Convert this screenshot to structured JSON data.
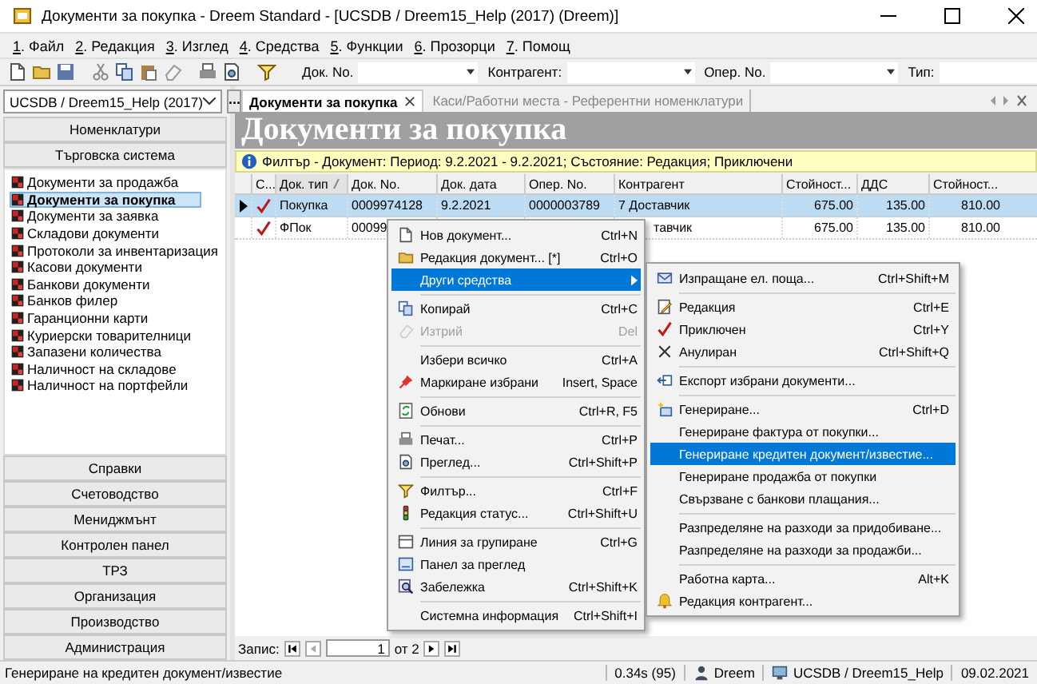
{
  "window": {
    "title": "Документи за покупка - Dreem Standard - [UCSDB / Dreem15_Help (2017) (Dreem)]"
  },
  "menu": [
    "1. Файл",
    "2. Редакция",
    "3. Изглед",
    "4. Средства",
    "5. Функции",
    "6. Прозорци",
    "7. Помощ"
  ],
  "toolbar": {
    "filters": [
      "Док. No.",
      "Контрагент:",
      "Опер. No.",
      "Тип:"
    ]
  },
  "sidebar": {
    "database": "UCSDB / Dreem15_Help (2017)",
    "more_button": "...",
    "sections_top": [
      "Номенклатури",
      "Търговска система"
    ],
    "items": [
      {
        "label": "Документи за продажба",
        "selected": false
      },
      {
        "label": "Документи за покупка",
        "selected": true
      },
      {
        "label": "Документи за заявка",
        "selected": false
      },
      {
        "label": "Складови документи",
        "selected": false
      },
      {
        "label": "Протоколи за инвентаризация",
        "selected": false
      },
      {
        "label": "Касови документи",
        "selected": false
      },
      {
        "label": "Банкови документи",
        "selected": false
      },
      {
        "label": "Банков филер",
        "selected": false
      },
      {
        "label": "Гаранционни карти",
        "selected": false
      },
      {
        "label": "Куриерски товарителници",
        "selected": false
      },
      {
        "label": "Запазени количества",
        "selected": false
      },
      {
        "label": "Наличност на складове",
        "selected": false
      },
      {
        "label": "Наличност на портфейли",
        "selected": false
      }
    ],
    "sections_bottom": [
      "Справки",
      "Счетоводство",
      "Мениджмънт",
      "Контролен панел",
      "ТРЗ",
      "Организация",
      "Производство",
      "Администрация"
    ]
  },
  "tabs": [
    {
      "label": "Документи за покупка",
      "selected": true,
      "closable": true
    },
    {
      "label": "Каси/Работни места - Референтни номенклатури",
      "selected": false,
      "closable": false
    }
  ],
  "page_title": "Документи за покупка",
  "filter_bar": "Филтър - Документ: Период: 9.2.2021 - 9.2.2021; Състояние: Редакция; Приключени",
  "table": {
    "columns": [
      {
        "label": "С...",
        "sorted": false
      },
      {
        "label": "Док. тип",
        "sorted": true
      },
      {
        "label": "Док. No.",
        "sorted": false
      },
      {
        "label": "Док. дата",
        "sorted": false
      },
      {
        "label": "Опер. No.",
        "sorted": false
      },
      {
        "label": "Контрагент",
        "sorted": false
      },
      {
        "label": "Стойност...",
        "sorted": false
      },
      {
        "label": "ДДС",
        "sorted": false
      },
      {
        "label": "Стойност...",
        "sorted": false
      }
    ],
    "rows": [
      {
        "selected": true,
        "checked": true,
        "doc_type": "Покупка",
        "doc_no": "0009974128",
        "doc_date": "9.2.2021",
        "oper_no": "0000003789",
        "contragent": "7 Доставчик",
        "value": "675.00",
        "vat": "135.00",
        "total": "810.00"
      },
      {
        "selected": false,
        "checked": true,
        "doc_type": "ФПок",
        "doc_no": "00099",
        "contragent": "тавчик",
        "value": "675.00",
        "vat": "135.00",
        "total": "810.00"
      }
    ]
  },
  "pager": {
    "label": "Запис:",
    "current": "1",
    "total": "от 2"
  },
  "context_menu": {
    "items": [
      {
        "kind": "item",
        "label": "Нов документ...",
        "shortcut": "Ctrl+N",
        "selected": false,
        "disabled": false
      },
      {
        "kind": "item",
        "label": "Редакция документ... [*]",
        "shortcut": "Ctrl+O",
        "selected": false,
        "disabled": false
      },
      {
        "kind": "submenu",
        "label": "Други средства",
        "selected": true,
        "disabled": false
      },
      {
        "kind": "separator"
      },
      {
        "kind": "item",
        "label": "Копирай",
        "shortcut": "Ctrl+C",
        "selected": false,
        "disabled": false
      },
      {
        "kind": "item",
        "label": "Изтрий",
        "shortcut": "Del",
        "selected": false,
        "disabled": true
      },
      {
        "kind": "separator"
      },
      {
        "kind": "item",
        "label": "Избери всичко",
        "shortcut": "Ctrl+A",
        "selected": false,
        "disabled": false
      },
      {
        "kind": "item",
        "label": "Маркиране избрани",
        "shortcut": "Insert, Space",
        "selected": false,
        "disabled": false
      },
      {
        "kind": "separator"
      },
      {
        "kind": "item",
        "label": "Обнови",
        "shortcut": "Ctrl+R, F5",
        "selected": false,
        "disabled": false
      },
      {
        "kind": "separator"
      },
      {
        "kind": "item",
        "label": "Печат...",
        "shortcut": "Ctrl+P",
        "selected": false,
        "disabled": false
      },
      {
        "kind": "item",
        "label": "Преглед...",
        "shortcut": "Ctrl+Shift+P",
        "selected": false,
        "disabled": false
      },
      {
        "kind": "separator"
      },
      {
        "kind": "item",
        "label": "Филтър...",
        "shortcut": "Ctrl+F",
        "selected": false,
        "disabled": false
      },
      {
        "kind": "item",
        "label": "Редакция статус...",
        "shortcut": "Ctrl+Shift+U",
        "selected": false,
        "disabled": false
      },
      {
        "kind": "separator"
      },
      {
        "kind": "item",
        "label": "Линия за групиране",
        "shortcut": "Ctrl+G",
        "selected": false,
        "disabled": false
      },
      {
        "kind": "item",
        "label": "Панел за преглед",
        "selected": false,
        "disabled": false
      },
      {
        "kind": "item",
        "label": "Забележка",
        "shortcut": "Ctrl+Shift+K",
        "selected": false,
        "disabled": false
      },
      {
        "kind": "separator"
      },
      {
        "kind": "item",
        "label": "Системна информация",
        "shortcut": "Ctrl+Shift+I",
        "selected": false,
        "disabled": false
      }
    ]
  },
  "submenu": {
    "items": [
      {
        "kind": "item",
        "label": "Изпращане ел. поща...",
        "shortcut": "Ctrl+Shift+M",
        "selected": false,
        "disabled": false
      },
      {
        "kind": "separator"
      },
      {
        "kind": "item",
        "label": "Редакция",
        "shortcut": "Ctrl+E",
        "selected": false,
        "disabled": false
      },
      {
        "kind": "item",
        "label": "Приключен",
        "shortcut": "Ctrl+Y",
        "selected": false,
        "disabled": false
      },
      {
        "kind": "item",
        "label": "Анулиран",
        "shortcut": "Ctrl+Shift+Q",
        "selected": false,
        "disabled": false
      },
      {
        "kind": "separator"
      },
      {
        "kind": "item",
        "label": "Експорт избрани документи...",
        "selected": false,
        "disabled": false
      },
      {
        "kind": "separator"
      },
      {
        "kind": "item",
        "label": "Генериране...",
        "shortcut": "Ctrl+D",
        "selected": false,
        "disabled": false
      },
      {
        "kind": "item",
        "label": "Генериране фактура от покупки...",
        "selected": false,
        "disabled": false
      },
      {
        "kind": "item",
        "label": "Генериране кредитен документ/известие...",
        "selected": true,
        "disabled": false
      },
      {
        "kind": "item",
        "label": "Генериране продажба от покупки",
        "selected": false,
        "disabled": false
      },
      {
        "kind": "item",
        "label": "Свързване с банкови плащания...",
        "selected": false,
        "disabled": false
      },
      {
        "kind": "separator"
      },
      {
        "kind": "item",
        "label": "Разпределяне на разходи за придобиване...",
        "selected": false,
        "disabled": false
      },
      {
        "kind": "item",
        "label": "Разпределяне на разходи за продажби...",
        "selected": false,
        "disabled": false
      },
      {
        "kind": "separator"
      },
      {
        "kind": "item",
        "label": "Работна карта...",
        "shortcut": "Alt+K",
        "selected": false,
        "disabled": false
      },
      {
        "kind": "item",
        "label": "Редакция контрагент...",
        "selected": false,
        "disabled": false
      }
    ]
  },
  "status_bar": {
    "message": "Генериране на кредитен документ/известие",
    "timing": "0.34s (95)",
    "user": "Dreem",
    "database": "UCSDB / Dreem15_Help",
    "date": "09.02.2021"
  }
}
